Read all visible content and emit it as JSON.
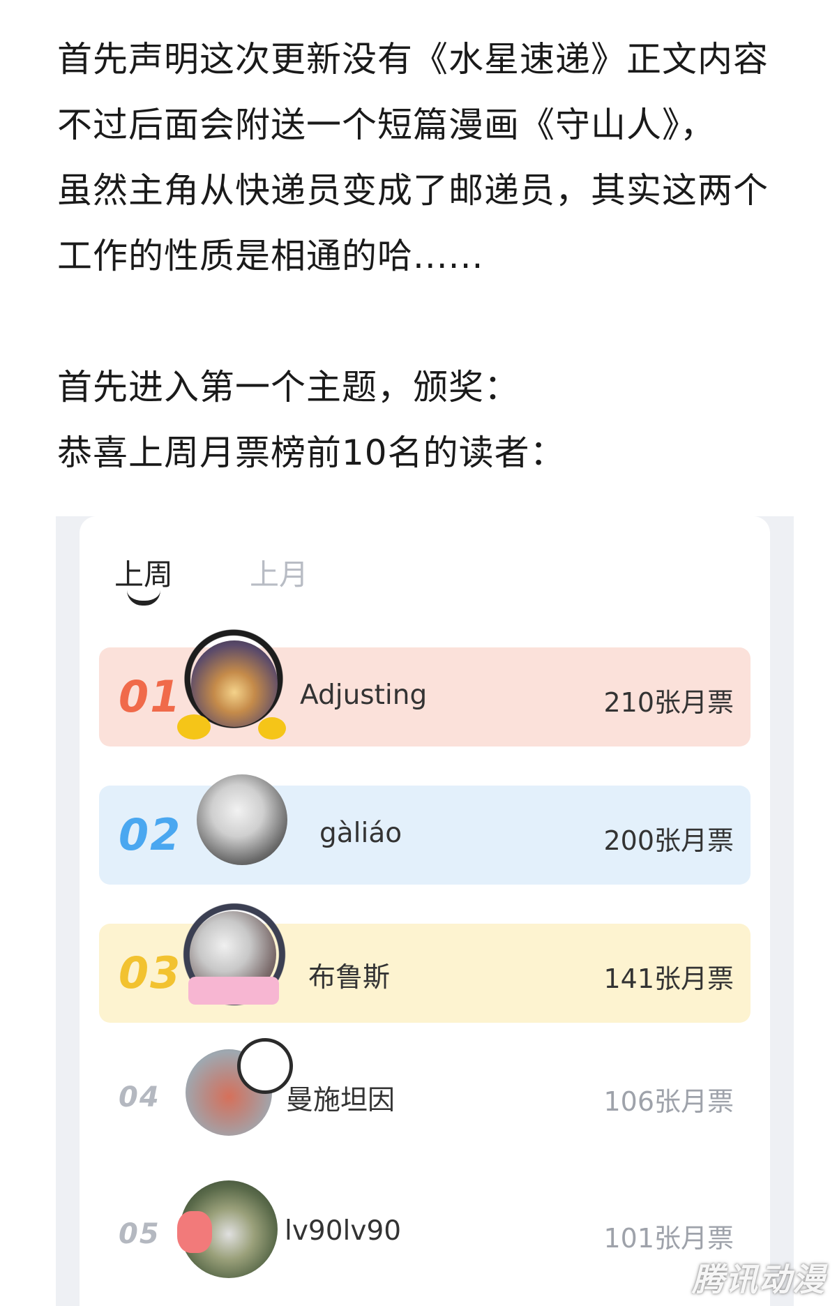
{
  "article": {
    "lines": [
      "首先声明这次更新没有《水星速递》正文内容",
      "不过后面会附送一个短篇漫画《守山人》，",
      "虽然主角从快递员变成了邮递员，其实这两个",
      "工作的性质是相通的哈......",
      "首先进入第一个主题，颁奖：",
      "恭喜上周月票榜前10名的读者："
    ]
  },
  "ranking": {
    "tabs": [
      {
        "label": "上周",
        "active": true
      },
      {
        "label": "上月",
        "active": false
      }
    ],
    "rows": [
      {
        "rank": "01",
        "name": "Adjusting",
        "votes": "210张月票"
      },
      {
        "rank": "02",
        "name": "gàliáo",
        "votes": "200张月票"
      },
      {
        "rank": "03",
        "name": "布鲁斯",
        "votes": "141张月票"
      },
      {
        "rank": "04",
        "name": "曼施坦因",
        "votes": "106张月票"
      },
      {
        "rank": "05",
        "name": "lv90lv90",
        "votes": "101张月票"
      }
    ],
    "colors": {
      "row1_bg": "#fbe1da",
      "row1_rank": "#f06a4a",
      "row2_bg": "#e3f0fb",
      "row2_rank": "#4aa7f0",
      "row3_bg": "#fdf3d0",
      "row3_rank": "#f2c230",
      "rank_muted": "#b4b8c0"
    }
  },
  "watermark": "腾讯动漫"
}
